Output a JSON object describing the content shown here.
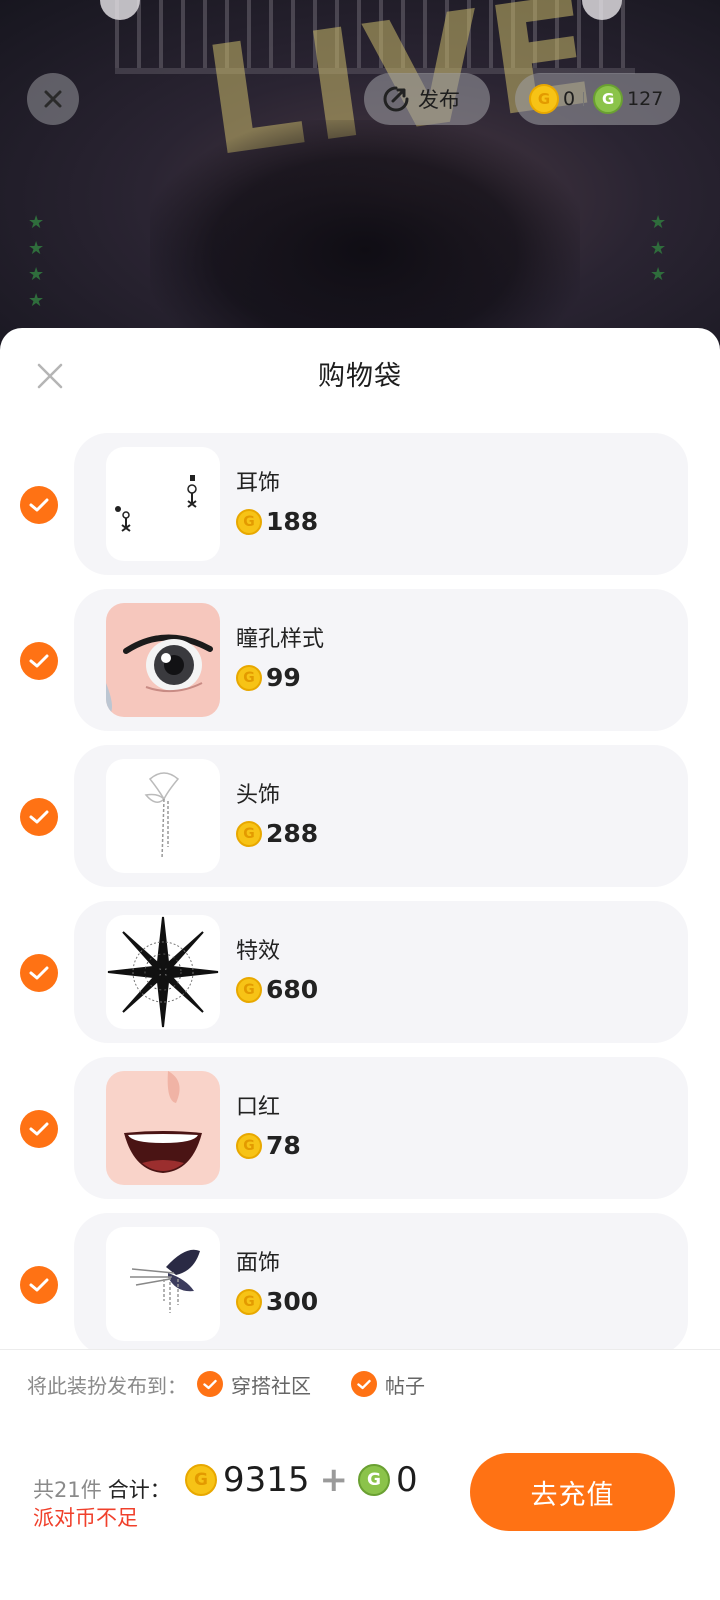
{
  "top_bar": {
    "publish_label": "发布",
    "gold_balance": "0",
    "green_balance": "127"
  },
  "scene": {
    "backdrop_text": "LIVE"
  },
  "sheet": {
    "title": "购物袋",
    "items": [
      {
        "name": "耳饰",
        "price": "188",
        "checked": true,
        "thumb_icon": "earring-icon"
      },
      {
        "name": "瞳孔样式",
        "price": "99",
        "checked": true,
        "thumb_icon": "eye-icon"
      },
      {
        "name": "头饰",
        "price": "288",
        "checked": true,
        "thumb_icon": "headpiece-icon"
      },
      {
        "name": "特效",
        "price": "680",
        "checked": true,
        "thumb_icon": "effect-icon"
      },
      {
        "name": "口红",
        "price": "78",
        "checked": true,
        "thumb_icon": "lipstick-icon"
      },
      {
        "name": "面饰",
        "price": "300",
        "checked": true,
        "thumb_icon": "face-accessory-icon"
      }
    ]
  },
  "publish_to": {
    "label": "将此装扮发布到：",
    "options": [
      {
        "label": "穿搭社区",
        "checked": true
      },
      {
        "label": "帖子",
        "checked": true
      }
    ]
  },
  "footer": {
    "count_text": "共21件",
    "total_label": "合计：",
    "gold_total": "9315",
    "plus": "+",
    "green_total": "0",
    "warning": "派对币不足",
    "recharge_label": "去充值"
  },
  "colors": {
    "accent": "#ff7214",
    "warning": "#f0402b",
    "card_bg": "#f5f5f8",
    "gold_coin": "#f7c316",
    "green_coin": "#8bc34a"
  }
}
